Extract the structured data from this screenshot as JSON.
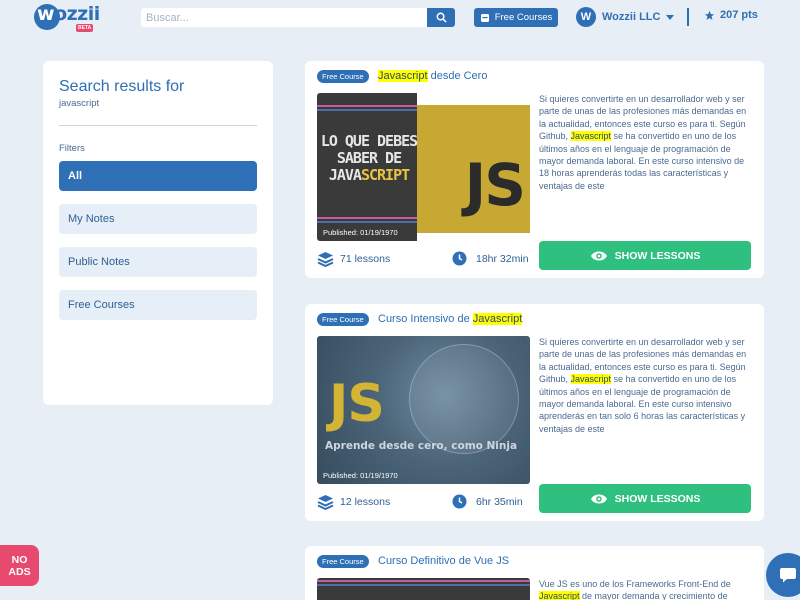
{
  "header": {
    "logo_text_w": "w",
    "logo_text_rest": "ozzii",
    "logo_badge": "BETA",
    "search_placeholder": "Buscar...",
    "free_courses_label": "Free Courses",
    "org_name": "Wozzii LLC",
    "org_initial": "W",
    "points_label": "207 pts"
  },
  "sidebar": {
    "title": "Search results for",
    "query": "javascript",
    "filters_label": "Filters",
    "items": [
      {
        "label": "All",
        "active": true
      },
      {
        "label": "My Notes",
        "active": false
      },
      {
        "label": "Public Notes",
        "active": false
      },
      {
        "label": "Free Courses",
        "active": false
      }
    ]
  },
  "courses": [
    {
      "badge": "Free Course",
      "title_pre": "",
      "title_hl": "Javascript",
      "title_post": " desde Cero",
      "published": "Published: 01/19/1970",
      "desc_1": "Si quieres convertirte en un desarrollador web y ser parte de unas de las profesiones más demandas en la actualidad, entonces este curso es para ti. Según Github, ",
      "desc_hl": "Javascript",
      "desc_2": " se ha convertido en uno de los últimos años en el lenguaje de programación de mayor demanda laboral. En este curso intensivo de 18 horas aprenderás todas las características y ventajas de este",
      "lessons": "71 lessons",
      "duration": "18hr 32min",
      "button": "SHOW LESSONS",
      "thumb_text_1": "LO QUE DEBES",
      "thumb_text_2": "SABER DE",
      "thumb_text_3a": "JAVA",
      "thumb_text_3b": "SCRIPT",
      "thumb_js": "JS"
    },
    {
      "badge": "Free Course",
      "title_pre": "Curso Intensivo de ",
      "title_hl": "Javascript",
      "title_post": "",
      "published": "Published: 01/19/1970",
      "desc_1": "Si quieres convertirte en un desarrollador web y ser parte de unas de las profesiones más demandas en la actualidad, entonces este curso es para ti. Según Github, ",
      "desc_hl": "Javascript",
      "desc_2": " se ha convertido en uno de los últimos años en el lenguaje de programación de mayor demanda laboral. En este curso intensivo aprenderás en tan solo 6 horas las características y ventajas de este",
      "lessons": "12 lessons",
      "duration": "6hr 35min",
      "button": "SHOW LESSONS",
      "thumb_js": "JS",
      "thumb_sub": "Aprende desde cero, como Ninja"
    },
    {
      "badge": "Free Course",
      "title_pre": "Curso Definitivo de Vue JS",
      "title_hl": "",
      "title_post": "",
      "desc_1": "Vue JS es uno de los Frameworks Front-End de ",
      "desc_hl": "Javascript",
      "desc_2": " de mayor demanda y crecimiento de"
    }
  ],
  "floating": {
    "noads_1": "NO",
    "noads_2": "ADS"
  },
  "colors": {
    "primary": "#2e6fb5",
    "success": "#2fbf7f",
    "highlight": "#ffff00",
    "noads": "#e84a6f"
  }
}
